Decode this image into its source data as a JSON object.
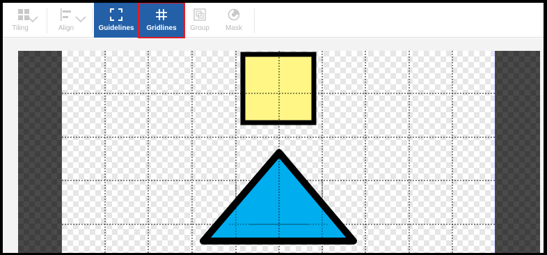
{
  "toolbar": {
    "tiling_label": "Tiling",
    "align_label": "Align",
    "guidelines_label": "Guidelines",
    "gridlines_label": "Gridlines",
    "group_label": "Group",
    "mask_label": "Mask",
    "active_button": "Gridlines",
    "highlight_color": "#e31b23",
    "active_bg": "#2460a7"
  },
  "canvas": {
    "shapes": [
      {
        "name": "square",
        "fill": "#fff685",
        "stroke": "#000000"
      },
      {
        "name": "triangle",
        "fill": "#00adef",
        "stroke": "#000000"
      }
    ],
    "gridlines": "on",
    "guideline_color": "#3a3aff"
  }
}
